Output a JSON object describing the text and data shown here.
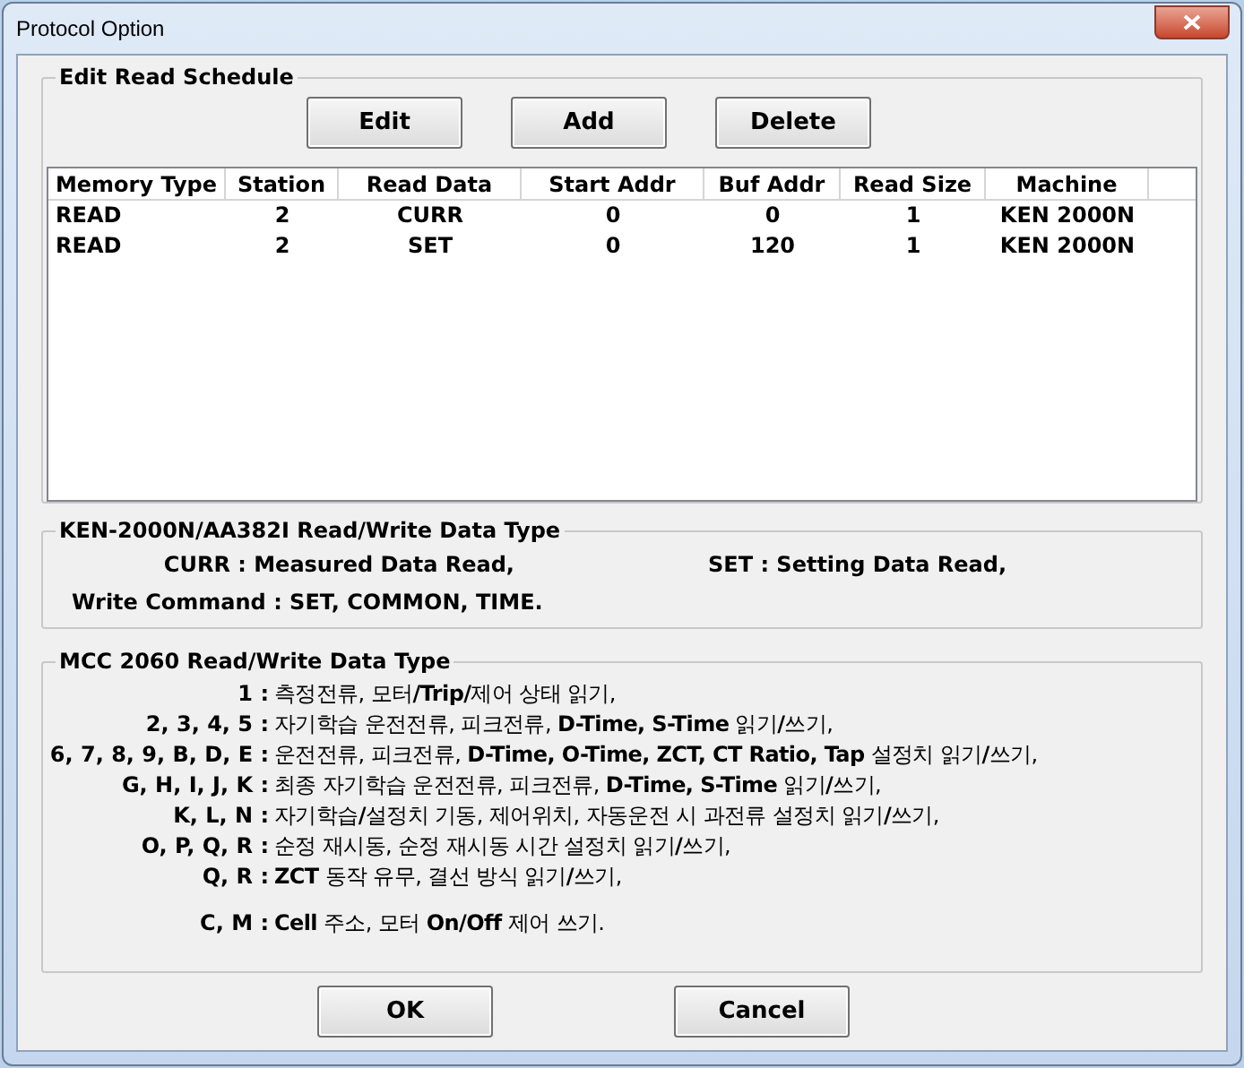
{
  "window": {
    "title": "Protocol Option"
  },
  "schedule": {
    "title": "Edit Read Schedule",
    "buttons": [
      "Edit",
      "Add",
      "Delete"
    ],
    "columns": [
      "Memory Type",
      "Station",
      "Read Data",
      "Start Addr",
      "Buf Addr",
      "Read Size",
      "Machine"
    ],
    "rows": [
      [
        "READ",
        "2",
        "CURR",
        "0",
        "0",
        "1",
        "KEN 2000N"
      ],
      [
        "READ",
        "2",
        "SET",
        "0",
        "120",
        "1",
        "KEN 2000N"
      ]
    ]
  },
  "ken_section": {
    "title": "KEN-2000N/AA382I Read/Write Data Type",
    "curr": "CURR : Measured Data Read,",
    "set": "SET : Setting Data Read,",
    "write": "Write Command : SET, COMMON, TIME."
  },
  "mcc_section": {
    "title": "MCC 2060 Read/Write Data Type",
    "lines": [
      {
        "label": "1 :",
        "text": "측정전류, 모터**/Trip/**제어 상태 읽기,"
      },
      {
        "label": "2, 3, 4, 5 :",
        "text": "자기학습 운전전류, 피크전류, **D-Time, S-Time** 읽기**/**쓰기,"
      },
      {
        "label": "6, 7, 8, 9, B, D, E :",
        "text": "운전전류, 피크전류, **D-Time, O-Time, ZCT, CT Ratio, Tap** 설정치 읽기**/**쓰기,"
      },
      {
        "label": "G, H, I, J, K :",
        "text": "최종 자기학습 운전전류, 피크전류, **D-Time, S-Time** 읽기**/**쓰기,"
      },
      {
        "label": "K, L, N :",
        "text": "자기학습**/**설정치 기동, 제어위치, 자동운전 시 과전류 설정치 읽기**/**쓰기,"
      },
      {
        "label": "O, P, Q, R :",
        "text": "순정 재시동, 순정 재시동 시간 설정치 읽기**/**쓰기,"
      },
      {
        "label": "Q, R :",
        "text": "**ZCT** 동작 유무, 결선 방식 읽기**/**쓰기,"
      },
      {
        "label": "C, M :",
        "text": "**Cell** 주소, 모터 **On/Off** 제어 쓰기.",
        "gap_before": true
      }
    ]
  },
  "buttons": [
    "OK",
    "Cancel"
  ]
}
